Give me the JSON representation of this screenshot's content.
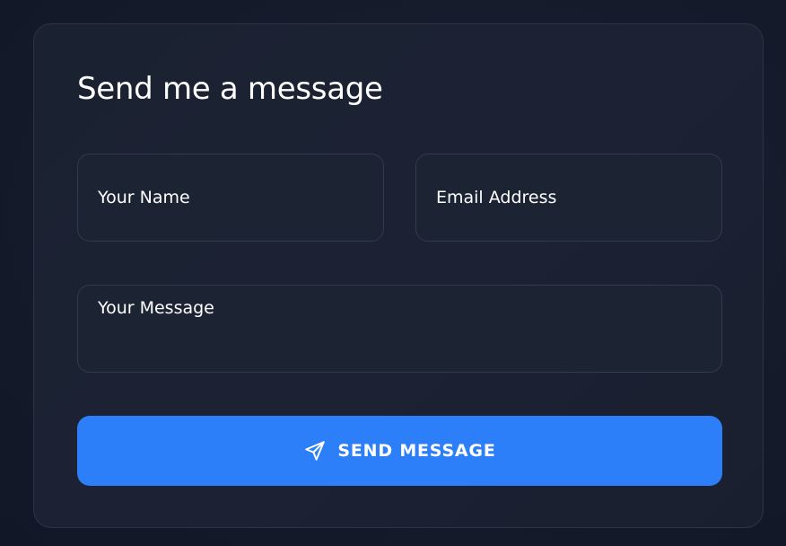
{
  "form": {
    "title": "Send me a message",
    "name_placeholder": "Your Name",
    "email_placeholder": "Email Address",
    "message_placeholder": "Your Message",
    "send_label": "SEND MESSAGE",
    "send_icon": "paper-plane-icon"
  },
  "colors": {
    "background": "#141a29",
    "card": "#1c2234",
    "field_border": "#323a4b",
    "accent": "#2d7ff9",
    "text": "#ffffff"
  }
}
